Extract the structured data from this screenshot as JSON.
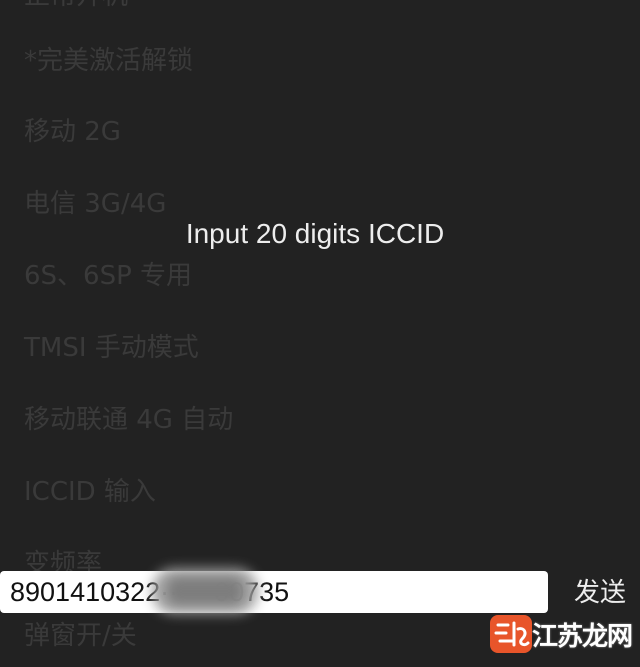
{
  "menu": {
    "items": [
      {
        "label": "正常开机"
      },
      {
        "label": "*完美激活解锁"
      },
      {
        "label": "移动 2G"
      },
      {
        "label": "电信 3G/4G"
      },
      {
        "label": "6S、6SP 专用"
      },
      {
        "label": "TMSI 手动模式"
      },
      {
        "label": "移动联通 4G 自动"
      },
      {
        "label": "ICCID 输入"
      },
      {
        "label": "变频率"
      },
      {
        "label": "弹窗开/关"
      }
    ]
  },
  "dialog": {
    "title": "Input 20 digits ICCID"
  },
  "input": {
    "value": "8901410322······00735",
    "send_label": "发送"
  },
  "watermark": {
    "text": "江苏龙网",
    "logo_icon": "jiangsu-longwang-logo",
    "accent_color": "#e8552a"
  },
  "colors": {
    "background": "#222222",
    "dim_text": "#3a3a3a",
    "dialog_text": "#ededed"
  }
}
